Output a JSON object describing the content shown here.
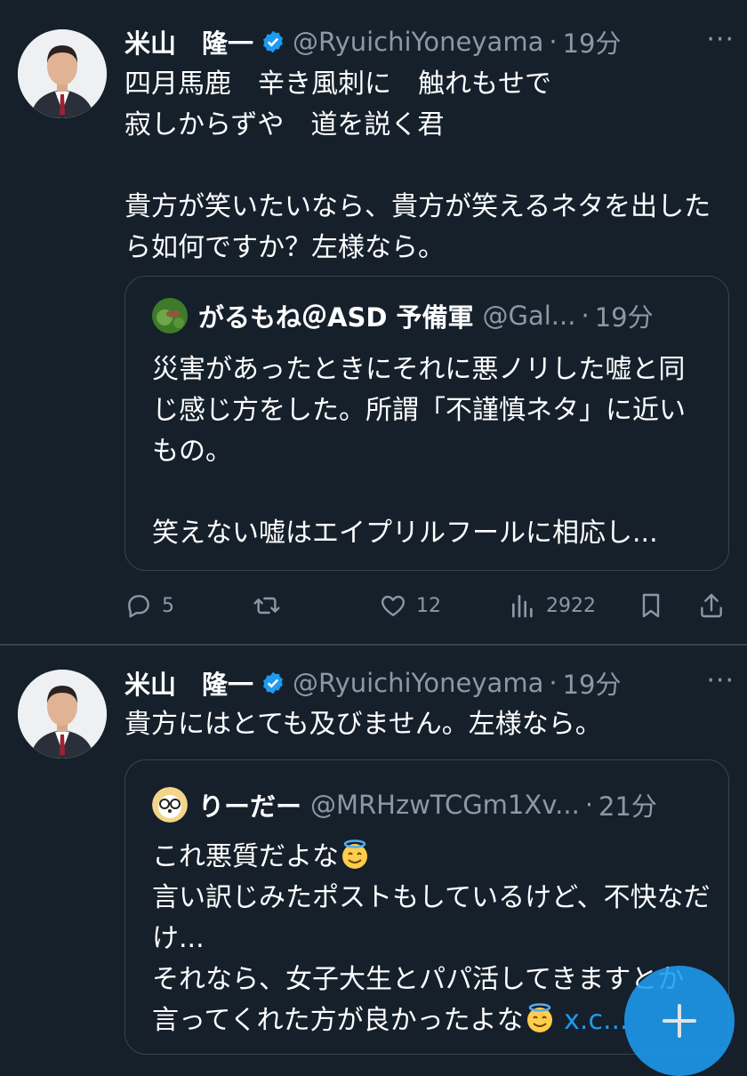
{
  "tweets": [
    {
      "author": {
        "name": "米山　隆一",
        "handle": "@RyuichiYoneyama"
      },
      "time": "19分",
      "text": "四月馬鹿　辛き風刺に　触れもせで\n寂しからずや　道を説く君\n\n貴方が笑いたいなら、貴方が笑えるネタを出したら如何ですか？左様なら。",
      "quote": {
        "name": "がるもね＠ASD 予備軍",
        "handle": "@Gal...",
        "time": "19分",
        "text": "災害があったときにそれに悪ノリした嘘と同じ感じ方をした。所謂「不謹慎ネタ」に近いもの。\n\n笑えない嘘はエイプリルフールに相応し..."
      },
      "stats": {
        "replies": "5",
        "retweets": "",
        "likes": "12",
        "views": "2922"
      }
    },
    {
      "author": {
        "name": "米山　隆一",
        "handle": "@RyuichiYoneyama"
      },
      "time": "19分",
      "text": "貴方にはとても及びません。左様なら。",
      "quote": {
        "name": "りーだー",
        "handle": "@MRHzwTCGm1Xv...",
        "time": "21分",
        "line1": "これ悪質だよな",
        "line2": "言い訳じみたポストもしているけど、不快なだけ...",
        "line3": "それなら、女子大生とパパ活してきますとか言ってくれた方が良かったよな",
        "link": "x.c..."
      }
    }
  ],
  "ui": {
    "dot": "·",
    "more": "···",
    "compose": "+"
  },
  "colors": {
    "background": "#15202b",
    "accent": "#1d9bf0",
    "muted": "#8b98a5",
    "border": "#38444d"
  }
}
